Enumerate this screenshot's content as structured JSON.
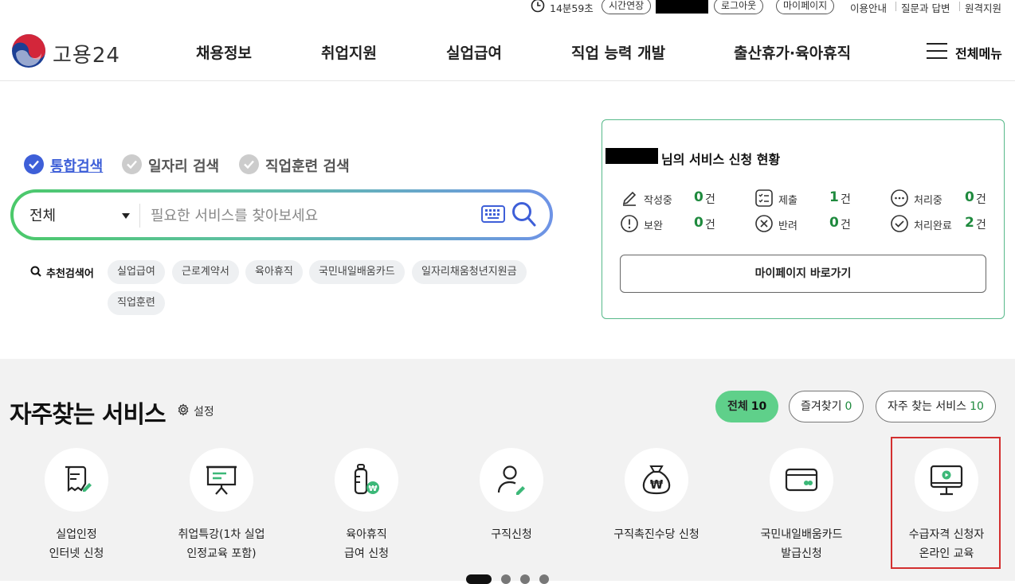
{
  "util": {
    "timer": "14분59초",
    "extend": "시간연장",
    "logout": "로그아웃",
    "mypage": "마이페이지",
    "links": [
      "이용안내",
      "질문과 답변",
      "원격지원"
    ]
  },
  "header": {
    "logo": "고용24",
    "nav": [
      "채용정보",
      "취업지원",
      "실업급여",
      "직업 능력 개발",
      "출산휴가·육아휴직"
    ],
    "menu": "전체메뉴"
  },
  "search": {
    "tabs": [
      "통합검색",
      "일자리 검색",
      "직업훈련 검색"
    ],
    "category": "전체",
    "placeholder": "필요한 서비스를 찾아보세요",
    "rec_label": "추천검색어",
    "keywords": [
      "실업급여",
      "근로계약서",
      "육아휴직",
      "국민내일배움카드",
      "일자리채움청년지원금",
      "직업훈련"
    ]
  },
  "status": {
    "title": "님의 서비스 신청 현황",
    "unit": "건",
    "items": [
      {
        "label": "작성중",
        "count": "0"
      },
      {
        "label": "제출",
        "count": "1"
      },
      {
        "label": "처리중",
        "count": "0"
      },
      {
        "label": "보완",
        "count": "0"
      },
      {
        "label": "반려",
        "count": "0"
      },
      {
        "label": "처리완료",
        "count": "2"
      }
    ],
    "button": "마이페이지 바로가기"
  },
  "frequent": {
    "title": "자주찾는 서비스",
    "settings": "설정",
    "tabs": [
      {
        "label": "전체",
        "count": "10"
      },
      {
        "label": "즐겨찾기",
        "count": "0"
      },
      {
        "label": "자주 찾는 서비스",
        "count": "10"
      }
    ],
    "services": [
      {
        "line1": "실업인정",
        "line2": "인터넷 신청",
        "icon": "document-pen-icon"
      },
      {
        "line1": "취업특강(1차 실업",
        "line2": "인정교육 포함)",
        "icon": "presentation-board-icon"
      },
      {
        "line1": "육아휴직",
        "line2": "급여 신청",
        "icon": "baby-bottle-won-icon"
      },
      {
        "line1": "구직신청",
        "line2": "",
        "icon": "person-pen-icon"
      },
      {
        "line1": "구직촉진수당 신청",
        "line2": "",
        "icon": "money-bag-icon"
      },
      {
        "line1": "국민내일배움카드",
        "line2": "발급신청",
        "icon": "card-icon"
      },
      {
        "line1": "수급자격 신청자",
        "line2": "온라인 교육",
        "icon": "monitor-play-icon"
      }
    ]
  },
  "colors": {
    "accent_blue": "#3e5fd8",
    "accent_green": "#1f8a3e",
    "tab_active": "#5fd08a",
    "highlight": "#d32f2f"
  }
}
